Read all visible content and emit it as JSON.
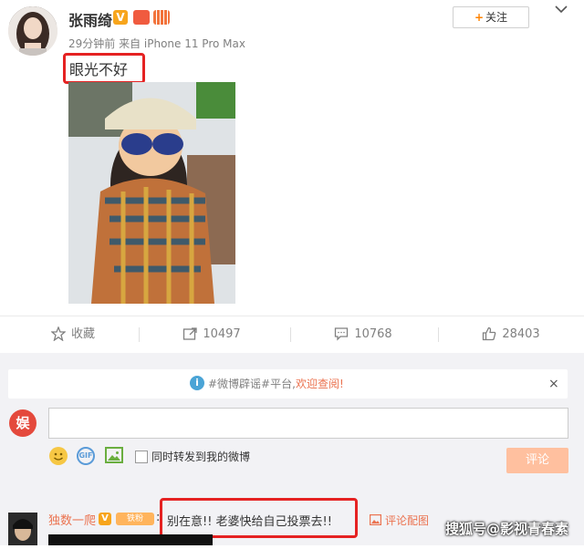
{
  "post": {
    "author": "张雨绮",
    "verified_badge": "V",
    "meta": "29分钟前 来自 iPhone 11 Pro Max",
    "text": "眼光不好",
    "follow_label": "关注",
    "follow_plus": "+"
  },
  "actions": {
    "favorite_label": "收藏",
    "repost_count": "10497",
    "comment_count": "10768",
    "like_count": "28403"
  },
  "notice": {
    "text": "#微博辟谣#平台,",
    "link": "欢迎查阅!",
    "close": "×"
  },
  "composer": {
    "avatar_text": "娱",
    "gif": "GIF",
    "repost_checkbox_label": "同时转发到我的微博",
    "submit_label": "评论"
  },
  "comment": {
    "user": "独数一爬",
    "verified_badge": "V",
    "badge": "铁粉",
    "colon": ":",
    "text": "别在意!! 老婆快给自己投票去!!",
    "action": "评论配图"
  },
  "watermark": "搜狐号@影视青春素",
  "colors": {
    "accent": "#eb7350",
    "highlight_box": "#e52222",
    "verified": "#f7a51c"
  },
  "icons": [
    "chevron-down-icon",
    "star-icon",
    "repost-icon",
    "comment-icon",
    "like-icon",
    "info-icon",
    "emoji-icon",
    "gif-icon",
    "image-icon",
    "picture-icon"
  ]
}
